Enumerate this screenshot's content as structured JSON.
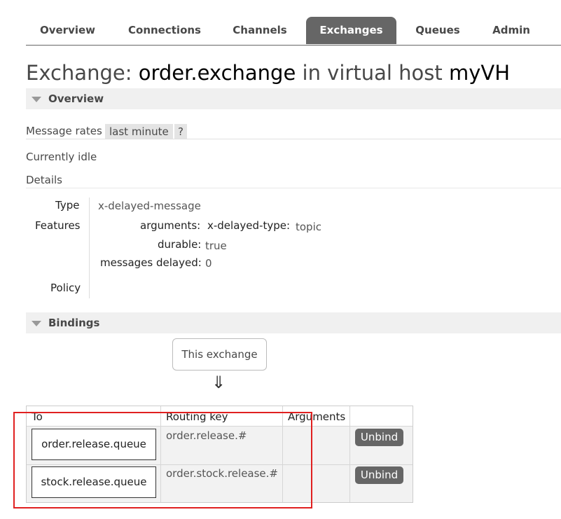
{
  "nav": {
    "tabs": [
      {
        "label": "Overview",
        "active": false
      },
      {
        "label": "Connections",
        "active": false
      },
      {
        "label": "Channels",
        "active": false
      },
      {
        "label": "Exchanges",
        "active": true
      },
      {
        "label": "Queues",
        "active": false
      },
      {
        "label": "Admin",
        "active": false
      }
    ]
  },
  "title": {
    "prefix": "Exchange:",
    "exchange_name": "order.exchange",
    "middle": "in virtual host",
    "vhost": "myVH"
  },
  "overview": {
    "section_label": "Overview",
    "message_rates_label": "Message rates",
    "rate_range": "last minute",
    "help_label": "?",
    "status": "Currently idle",
    "details_label": "Details",
    "type_key": "Type",
    "type_value": "x-delayed-message",
    "features_key": "Features",
    "arguments_key": "arguments:",
    "delayed_type_key": "x-delayed-type:",
    "delayed_type_value": "topic",
    "durable_key": "durable:",
    "durable_value": "true",
    "messages_delayed_key": "messages delayed:",
    "messages_delayed_value": "0",
    "policy_key": "Policy"
  },
  "bindings": {
    "section_label": "Bindings",
    "source_label": "This exchange",
    "arrow": "⇓",
    "columns": [
      "To",
      "Routing key",
      "Arguments",
      ""
    ],
    "rows": [
      {
        "to": "order.release.queue",
        "routing_key": "order.release.#",
        "arguments": "",
        "action": "Unbind"
      },
      {
        "to": "stock.release.queue",
        "routing_key": "order.stock.release.#",
        "arguments": "",
        "action": "Unbind"
      }
    ]
  },
  "colors": {
    "active_tab": "#666666",
    "highlight_border": "#e02020",
    "section_bg": "#f0f0f0"
  }
}
